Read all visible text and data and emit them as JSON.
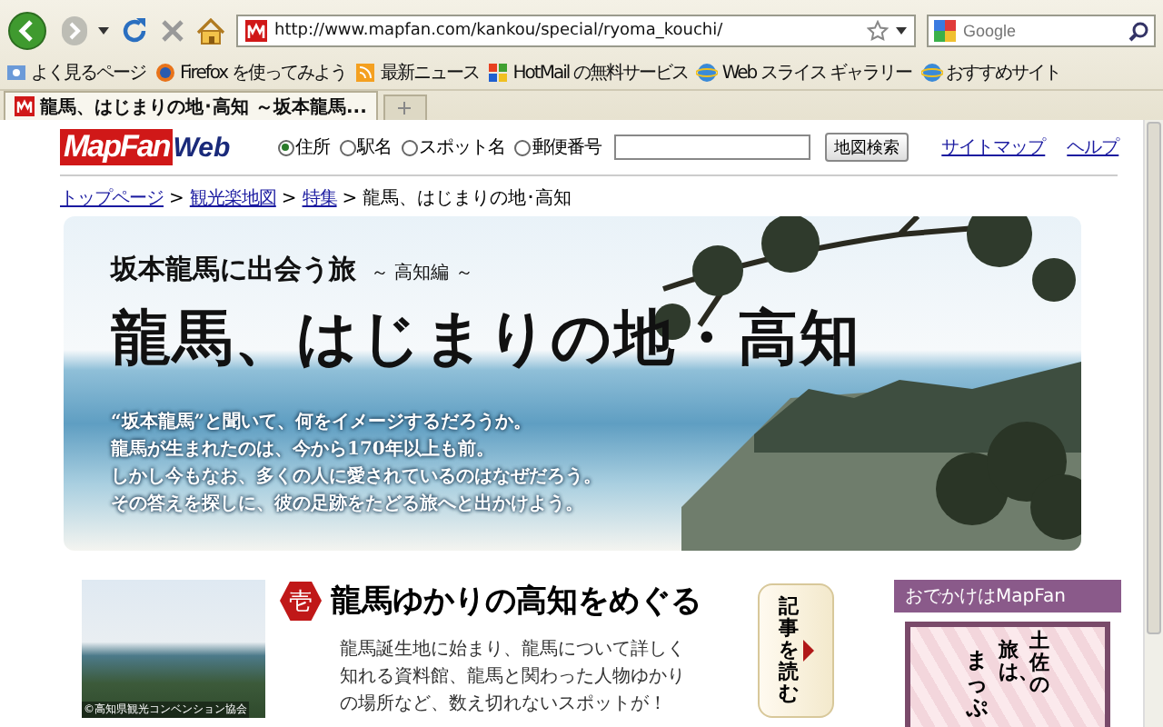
{
  "browser": {
    "url": "http://www.mapfan.com/kankou/special/ryoma_kouchi/",
    "search_placeholder": "Google",
    "bookmarks": [
      {
        "label": "よく見るページ"
      },
      {
        "label": "Firefox を使ってみよう"
      },
      {
        "label": "最新ニュース"
      },
      {
        "label": "HotMail の無料サービス"
      },
      {
        "label": "Web スライス ギャラリー"
      },
      {
        "label": "おすすめサイト"
      }
    ],
    "tabs": [
      {
        "title": "龍馬、はじまりの地･高知 ～坂本龍馬...",
        "selected": true
      }
    ]
  },
  "header": {
    "logo_main": "MapFan",
    "logo_sub": "Web",
    "radios": [
      {
        "label": "住所",
        "selected": true
      },
      {
        "label": "駅名",
        "selected": false
      },
      {
        "label": "スポット名",
        "selected": false
      },
      {
        "label": "郵便番号",
        "selected": false
      }
    ],
    "search_button": "地図検索",
    "links": [
      "サイトマップ",
      "ヘルプ"
    ]
  },
  "breadcrumb": [
    {
      "label": "トップページ",
      "link": true
    },
    {
      "separator": ">",
      "label": "観光楽地図",
      "link": true
    },
    {
      "separator": ">",
      "label": "特集",
      "link": true
    },
    {
      "separator": ">",
      "label": "龍馬、はじまりの地･高知",
      "link": false
    }
  ],
  "hero": {
    "subtitle": "坂本龍馬に出会う旅",
    "subtitle_note": "～ 高知編 ～",
    "title": "龍馬、はじまりの地・高知",
    "lines": [
      "“坂本龍馬”と聞いて、何をイメージするだろうか。",
      "龍馬が生まれたのは、今から170年以上も前。",
      "しかし今もなお、多くの人に愛されているのはなぜだろう。",
      "その答えを探しに、彼の足跡をたどる旅へと出かけよう。"
    ]
  },
  "feature": {
    "photo_credit": "©高知県観光コンベンション協会",
    "badge": "壱",
    "title": "龍馬ゆかりの高知をめぐる",
    "text": "龍馬誕生地に始まり、龍馬について詳しく知れる資料館、龍馬と関わった人物ゆかりの場所など、数え切れないスポットが！",
    "read_button": "記事を読む"
  },
  "sidebar": {
    "heading": "おでかけはMapFan",
    "ad_columns": [
      "土佐の",
      "旅は、",
      "まっぷ"
    ]
  }
}
